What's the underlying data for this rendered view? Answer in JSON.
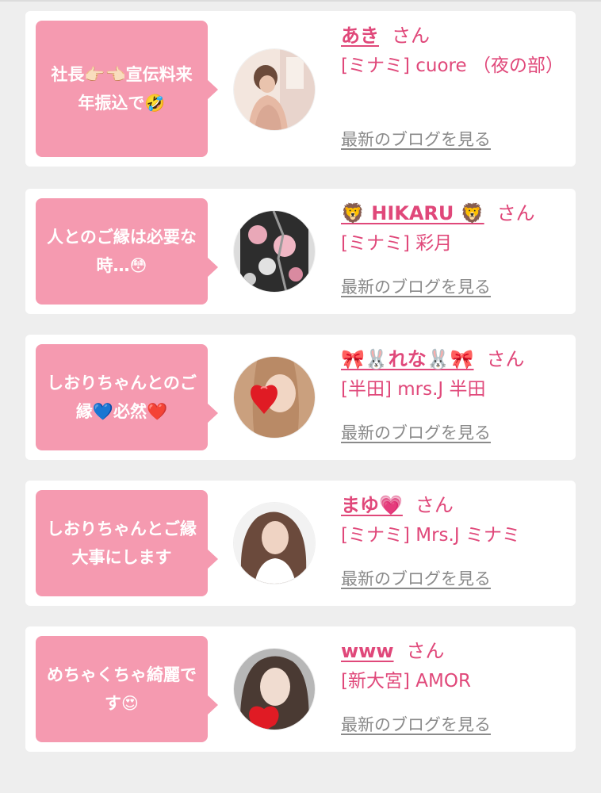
{
  "cards": [
    {
      "message": "社長👉🏻👈🏻宣伝料来年振込で🤣",
      "name": "あき",
      "honorific": "さん",
      "shop": "[ミナミ] cuore （夜の部）",
      "blog_link": "最新のブログを見る",
      "avatar_icon": "avatar-photo"
    },
    {
      "message": "人とのご縁は必要な時…😳",
      "name": "🦁 HIKARU 🦁",
      "honorific": "さん",
      "shop": "[ミナミ] 彩月",
      "blog_link": "最新のブログを見る",
      "avatar_icon": "avatar-photo"
    },
    {
      "message": "しおりちゃんとのご縁💙必然❤️",
      "name": "🎀🐰れな🐰🎀",
      "honorific": "さん",
      "shop": "[半田] mrs.J 半田",
      "blog_link": "最新のブログを見る",
      "avatar_icon": "avatar-photo"
    },
    {
      "message": "しおりちゃんとご縁大事にします",
      "name": "まゆ💗",
      "honorific": "さん",
      "shop": "[ミナミ] Mrs.J ミナミ",
      "blog_link": "最新のブログを見る",
      "avatar_icon": "avatar-photo"
    },
    {
      "message": "めちゃくちゃ綺麗です😍",
      "name": "www",
      "honorific": "さん",
      "shop": "[新大宮] AMOR",
      "blog_link": "最新のブログを見る",
      "avatar_icon": "avatar-photo"
    }
  ],
  "colors": {
    "bubble": "#f59ab0",
    "accent": "#e0487a",
    "link_gray": "#8a8a8a",
    "background": "#eeeeee"
  }
}
